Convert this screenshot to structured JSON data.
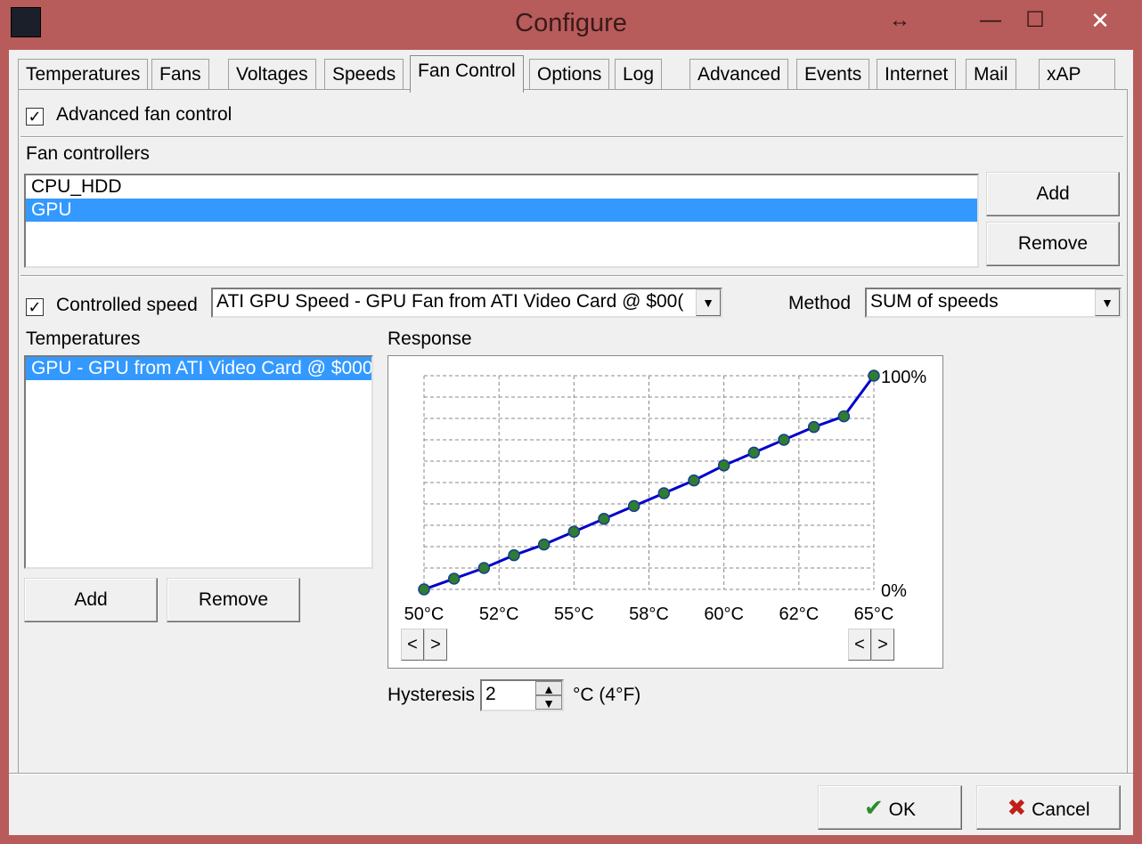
{
  "window": {
    "title": "Configure",
    "controls": [
      "↔",
      "—",
      "☐",
      "✕"
    ]
  },
  "tabs": [
    "Temperatures",
    "Fans",
    "Voltages",
    "Speeds",
    "Fan Control",
    "Options",
    "Log",
    "Advanced",
    "Events",
    "Internet",
    "Mail",
    "xAP"
  ],
  "active_tab": "Fan Control",
  "advanced_fan_control": {
    "label": "Advanced fan control",
    "checked": true
  },
  "fan_controllers": {
    "label": "Fan controllers",
    "items": [
      "CPU_HDD",
      "GPU"
    ],
    "selected": "GPU",
    "add_label": "Add",
    "remove_label": "Remove"
  },
  "controlled_speed": {
    "label": "Controlled speed",
    "checked": true,
    "value": "ATI GPU Speed - GPU Fan from ATI Video Card @ $00("
  },
  "method": {
    "label": "Method",
    "value": "SUM of speeds"
  },
  "temperatures": {
    "label": "Temperatures",
    "items": [
      "GPU - GPU from ATI Video Card @ $000"
    ],
    "add_label": "Add",
    "remove_label": "Remove"
  },
  "response": {
    "label": "Response",
    "left_arrow": "<",
    "right_arrow": ">"
  },
  "chart_data": {
    "type": "line",
    "x_tick_labels": [
      "50°C",
      "52°C",
      "55°C",
      "58°C",
      "60°C",
      "62°C",
      "65°C"
    ],
    "y_tick_labels": [
      "0%",
      "100%"
    ],
    "x": [
      50,
      51,
      52,
      53,
      54,
      55,
      56,
      57,
      58,
      59,
      60,
      61,
      62,
      63,
      64,
      65
    ],
    "y": [
      0,
      5,
      10,
      16,
      21,
      27,
      33,
      39,
      45,
      51,
      58,
      64,
      70,
      76,
      81,
      100
    ],
    "xlim": [
      50,
      65
    ],
    "ylim": [
      0,
      100
    ],
    "grid": true,
    "line_color": "#0000cc",
    "marker_color": "#2e7d32"
  },
  "hysteresis": {
    "label": "Hysteresis",
    "value": "2",
    "unit": "°C (4°F)"
  },
  "footer": {
    "ok_label": "OK",
    "cancel_label": "Cancel"
  }
}
